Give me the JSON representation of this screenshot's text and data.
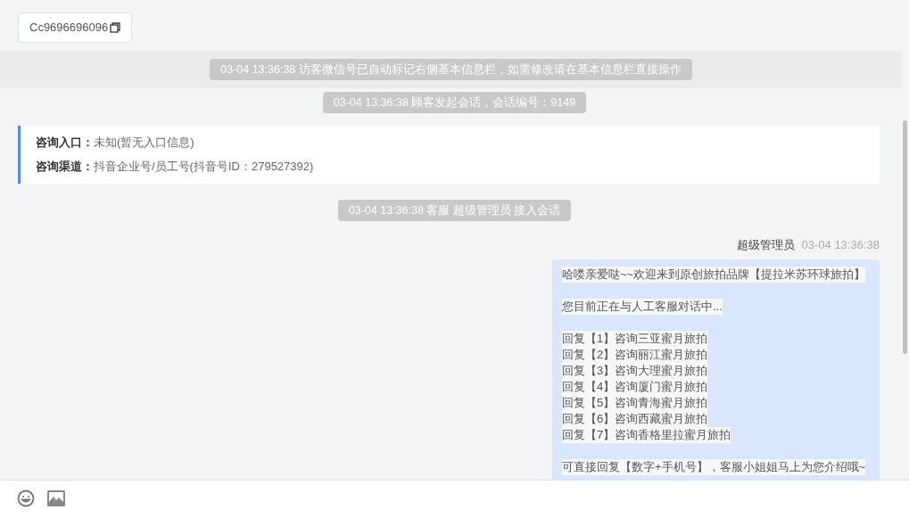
{
  "copy_chip": {
    "text": "Cc9696696096"
  },
  "notices": [
    {
      "kind": "highlight",
      "text": "03-04 13:36:38 访客微信号已自动标记右侧基本信息栏，如需修改请在基本信息栏直接操作"
    },
    {
      "kind": "plain",
      "text": "03-04 13:36:38 顾客发起会话，会话编号：9149"
    }
  ],
  "info_card": {
    "rows": [
      {
        "label": "咨询入口：",
        "value": "未知(暂无入口信息)"
      },
      {
        "label": "咨询渠道：",
        "value": "抖音企业号/员工号(抖音号ID：279527392)"
      }
    ]
  },
  "join_notice": "03-04 13:36:38 客服 超级管理员 接入会话",
  "message": {
    "sender": "超级管理员",
    "time": "03-04 13:36:38",
    "paragraphs": [
      [
        "哈喽亲爱哒~~欢迎来到原创旅拍品牌【提拉米苏环球旅拍】"
      ],
      [
        "您目前正在与人工客服对话中..."
      ],
      [
        "回复【1】咨询三亚蜜月旅拍",
        "回复【2】咨询丽江蜜月旅拍",
        "回复【3】咨询大理蜜月旅拍",
        "回复【4】咨询厦门蜜月旅拍",
        "回复【5】咨询青海蜜月旅拍",
        "回复【6】咨询西藏蜜月旅拍",
        "回复【7】咨询香格里拉蜜月旅拍"
      ],
      [
        "可直接回复【数字+手机号】，客服小姐姐马上为您介绍哦~"
      ]
    ]
  }
}
